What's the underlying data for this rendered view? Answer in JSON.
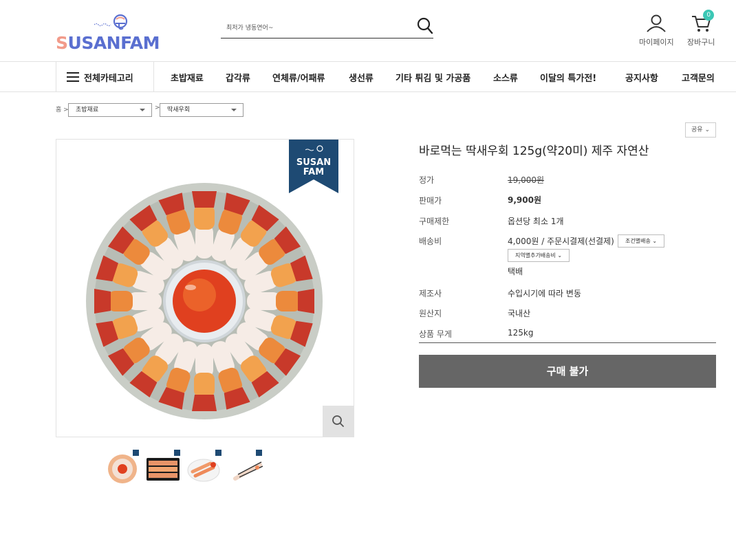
{
  "header": {
    "logo_text_first": "S",
    "logo_text_rest": "USANFAM",
    "search": {
      "placeholder": "최저가 냉동연어~"
    },
    "mypage_label": "마이페이지",
    "cart_label": "장바구니",
    "cart_count": "0",
    "accent_color": "#3cc7b5"
  },
  "nav": {
    "all_category": "전체카테고리",
    "items": [
      "초밥재료",
      "갑각류",
      "연체류/어패류",
      "생선류",
      "기타 튀김 및 가공품",
      "소스류",
      "이달의 특가전!",
      "공지사항",
      "고객문의"
    ]
  },
  "breadcrumb": {
    "home": "홈 >",
    "separator": ">",
    "level1": "초밥재료",
    "level2": "딱새우회"
  },
  "gallery": {
    "badge_line1": "SUSAN",
    "badge_line2": "FAM",
    "zoom_icon": "search-icon"
  },
  "product": {
    "share_label": "공유",
    "title": "바로먹는 딱새우회 125g(약20미) 제주 자연산",
    "rows": [
      {
        "label": "정가",
        "value": "19,000원"
      },
      {
        "label": "판매가",
        "value": "9,900원"
      },
      {
        "label": "구매제한",
        "value": "옵션당 최소 1개"
      },
      {
        "label": "배송비",
        "value": "4,000원  / 주문시결제(선결제)"
      },
      {
        "label": "제조사",
        "value": "수입시기에 따라 변동"
      },
      {
        "label": "원산지",
        "value": "국내산"
      },
      {
        "label": "상품 무게",
        "value": "125kg"
      }
    ],
    "shipping_condition_btn": "조건별배송",
    "shipping_region_btn": "지역별추가배송비",
    "shipping_method": "택배",
    "buy_button": "구매 불가"
  }
}
